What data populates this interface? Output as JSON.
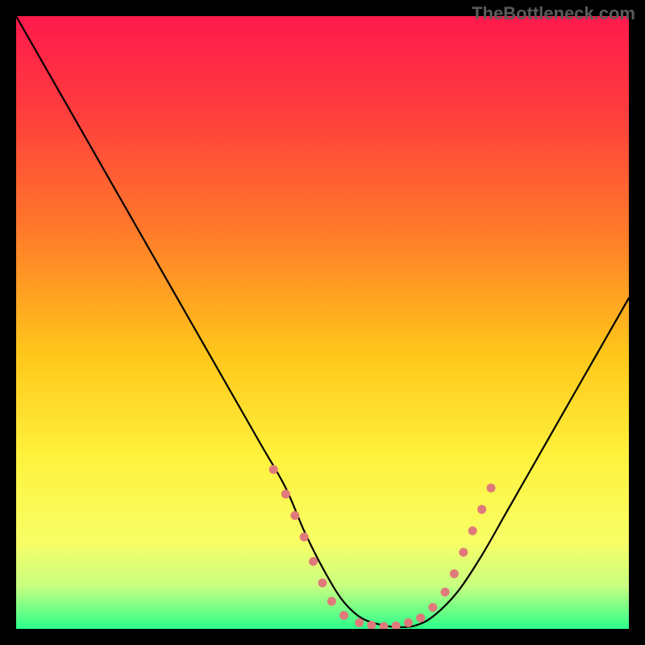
{
  "watermark": "TheBottleneck.com",
  "chart_data": {
    "type": "line",
    "title": "",
    "xlabel": "",
    "ylabel": "",
    "xlim": [
      0,
      100
    ],
    "ylim": [
      0,
      100
    ],
    "gradient_stops": [
      {
        "offset": 0.0,
        "color": "#ff1a4d"
      },
      {
        "offset": 0.15,
        "color": "#ff3b3e"
      },
      {
        "offset": 0.35,
        "color": "#ff7a2a"
      },
      {
        "offset": 0.55,
        "color": "#ffc61a"
      },
      {
        "offset": 0.72,
        "color": "#fff23d"
      },
      {
        "offset": 0.86,
        "color": "#f7ff66"
      },
      {
        "offset": 0.93,
        "color": "#c8ff80"
      },
      {
        "offset": 1.0,
        "color": "#2bff8a"
      }
    ],
    "series": [
      {
        "name": "bottleneck-curve",
        "x": [
          0,
          4,
          8,
          12,
          16,
          20,
          24,
          28,
          32,
          36,
          40,
          44,
          47,
          50,
          53,
          56,
          59,
          62,
          65,
          68,
          72,
          76,
          80,
          84,
          88,
          92,
          96,
          100
        ],
        "y": [
          100,
          93,
          86,
          79,
          72,
          65,
          58,
          51,
          44,
          37,
          30,
          23,
          16,
          10,
          5,
          2,
          0.8,
          0.3,
          0.5,
          2,
          6,
          12,
          19,
          26,
          33,
          40,
          47,
          54
        ]
      }
    ],
    "markers": {
      "name": "highlight-dots",
      "color": "#e07a7a",
      "radius": 5.5,
      "points": [
        {
          "x": 42,
          "y": 26
        },
        {
          "x": 44,
          "y": 22
        },
        {
          "x": 45.5,
          "y": 18.5
        },
        {
          "x": 47,
          "y": 15
        },
        {
          "x": 48.5,
          "y": 11
        },
        {
          "x": 50,
          "y": 7.5
        },
        {
          "x": 51.5,
          "y": 4.5
        },
        {
          "x": 53.5,
          "y": 2.2
        },
        {
          "x": 56,
          "y": 1.0
        },
        {
          "x": 58,
          "y": 0.6
        },
        {
          "x": 60,
          "y": 0.4
        },
        {
          "x": 62,
          "y": 0.5
        },
        {
          "x": 64,
          "y": 1.0
        },
        {
          "x": 66,
          "y": 1.8
        },
        {
          "x": 68,
          "y": 3.5
        },
        {
          "x": 70,
          "y": 6.0
        },
        {
          "x": 71.5,
          "y": 9.0
        },
        {
          "x": 73,
          "y": 12.5
        },
        {
          "x": 74.5,
          "y": 16.0
        },
        {
          "x": 76,
          "y": 19.5
        },
        {
          "x": 77.5,
          "y": 23.0
        }
      ]
    }
  }
}
